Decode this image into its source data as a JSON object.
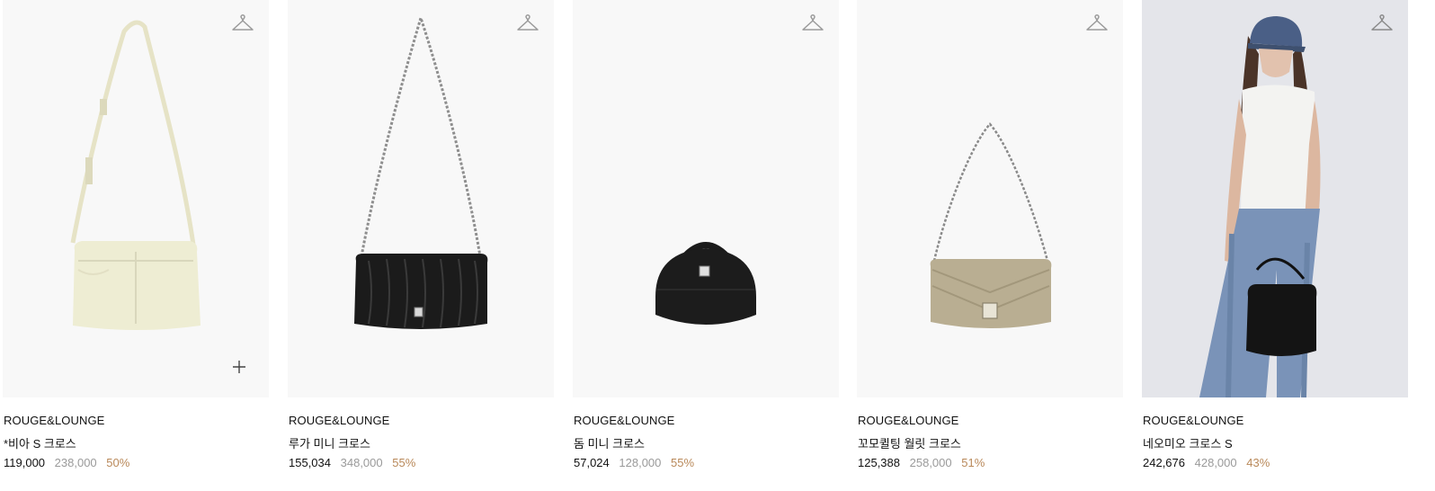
{
  "products": [
    {
      "brand": "ROUGE&LOUNGE",
      "name": "*비아 S 크로스",
      "price": "119,000",
      "original_price": "238,000",
      "discount": "50%",
      "image": "cream-crossbody-bag",
      "wishlist_icon": "hanger-icon",
      "quick_add_icon": "plus-icon"
    },
    {
      "brand": "ROUGE&LOUNGE",
      "name": "루가 미니 크로스",
      "price": "155,034",
      "original_price": "348,000",
      "discount": "55%",
      "image": "black-pleated-chain-bag",
      "wishlist_icon": "hanger-icon"
    },
    {
      "brand": "ROUGE&LOUNGE",
      "name": "돔 미니 크로스",
      "price": "57,024",
      "original_price": "128,000",
      "discount": "55%",
      "image": "black-dome-mini-bag",
      "wishlist_icon": "hanger-icon"
    },
    {
      "brand": "ROUGE&LOUNGE",
      "name": "꼬모퀼팅 월릿 크로스",
      "price": "125,388",
      "original_price": "258,000",
      "discount": "51%",
      "image": "beige-quilted-chain-wallet",
      "wishlist_icon": "hanger-icon"
    },
    {
      "brand": "ROUGE&LOUNGE",
      "name": "네오미오 크로스 S",
      "price": "242,676",
      "original_price": "428,000",
      "discount": "43%",
      "image": "model-with-black-bag-photo",
      "wishlist_icon": "hanger-icon"
    }
  ],
  "colors": {
    "price": "#111111",
    "original_price": "#9a9a9a",
    "discount": "#b9895a",
    "thumb_bg": "#f8f8f8"
  }
}
